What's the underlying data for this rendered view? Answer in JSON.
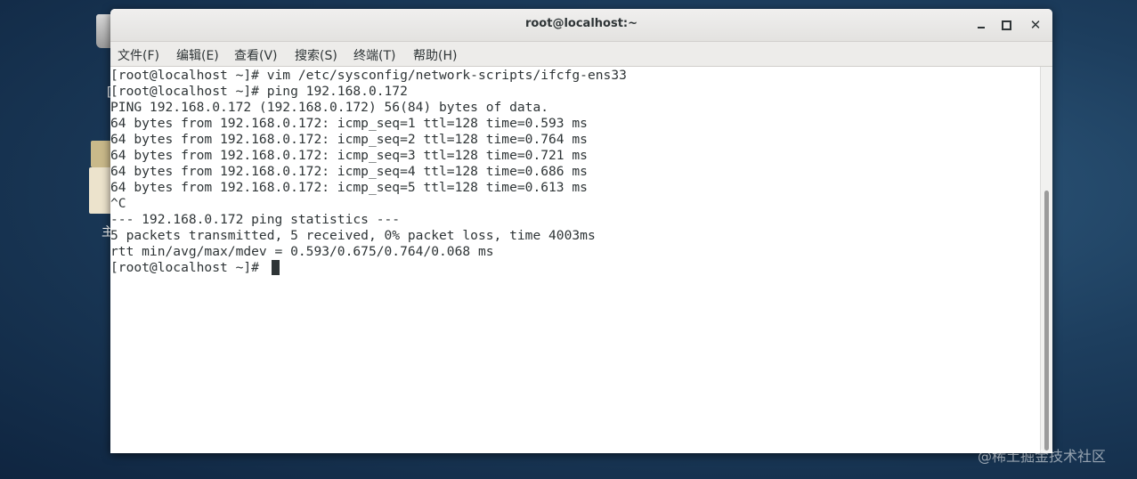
{
  "window": {
    "title": "root@localhost:~",
    "controls": {
      "minimize": "minimize",
      "maximize": "maximize",
      "close": "✕"
    }
  },
  "menu": [
    "文件(F)",
    "编辑(E)",
    "查看(V)",
    "搜索(S)",
    "终端(T)",
    "帮助(H)"
  ],
  "terminal": {
    "lines": [
      "[root@localhost ~]# vim /etc/sysconfig/network-scripts/ifcfg-ens33",
      "[root@localhost ~]# ping 192.168.0.172",
      "PING 192.168.0.172 (192.168.0.172) 56(84) bytes of data.",
      "64 bytes from 192.168.0.172: icmp_seq=1 ttl=128 time=0.593 ms",
      "64 bytes from 192.168.0.172: icmp_seq=2 ttl=128 time=0.764 ms",
      "64 bytes from 192.168.0.172: icmp_seq=3 ttl=128 time=0.721 ms",
      "64 bytes from 192.168.0.172: icmp_seq=4 ttl=128 time=0.686 ms",
      "64 bytes from 192.168.0.172: icmp_seq=5 ttl=128 time=0.613 ms",
      "^C",
      "--- 192.168.0.172 ping statistics ---",
      "5 packets transmitted, 5 received, 0% packet loss, time 4003ms",
      "rtt min/avg/max/mdev = 0.593/0.675/0.764/0.068 ms",
      "[root@localhost ~]# "
    ]
  },
  "desktop": {
    "glyph_left": "[",
    "glyph_lower": "主"
  },
  "watermark": "@稀土掘金技术社区",
  "colors": {
    "terminal_bg": "#ffffff",
    "terminal_fg": "#2e3436",
    "titlebar": "#e8e7e5"
  }
}
